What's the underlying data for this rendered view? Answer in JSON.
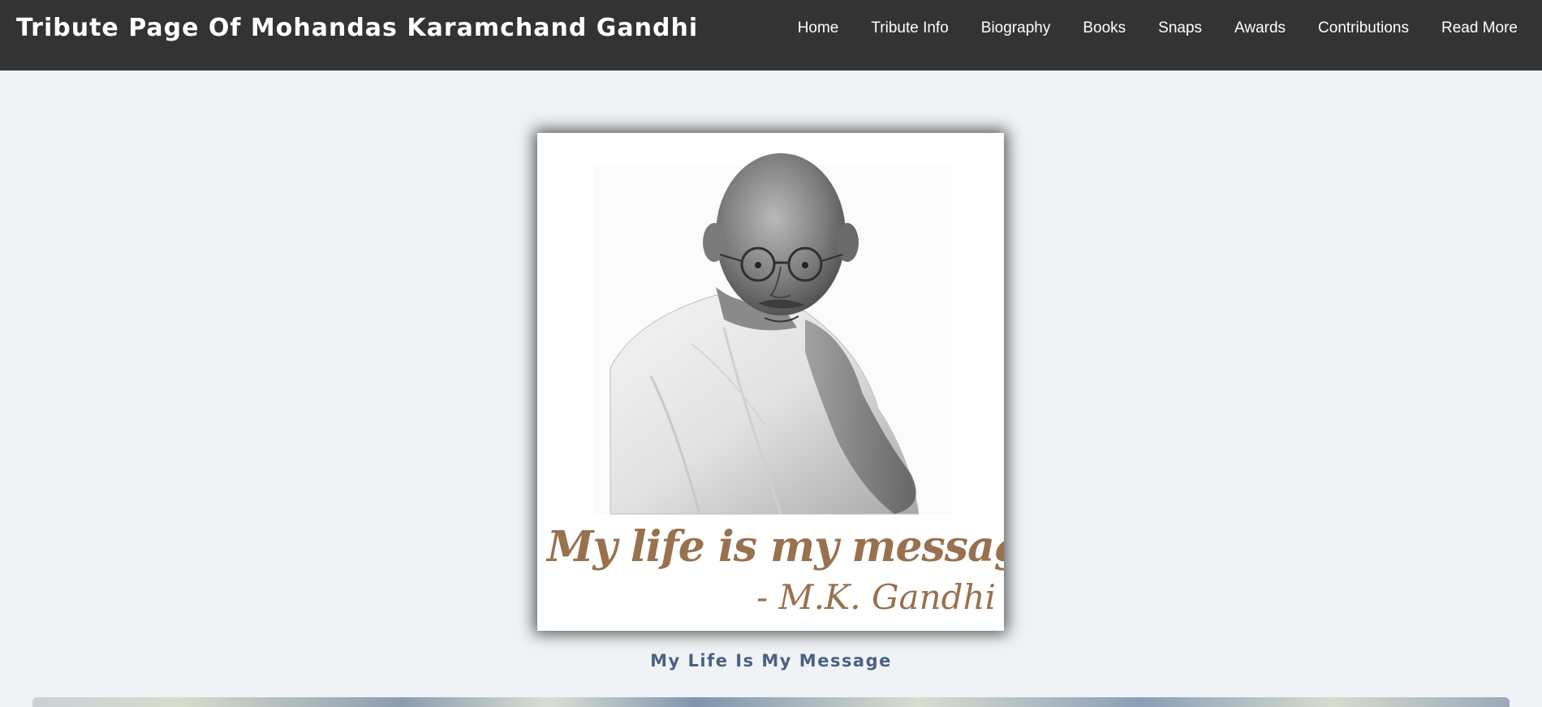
{
  "header": {
    "title": "Tribute Page Of Mohandas Karamchand Gandhi",
    "nav": [
      {
        "label": "Home"
      },
      {
        "label": "Tribute Info"
      },
      {
        "label": "Biography"
      },
      {
        "label": "Books"
      },
      {
        "label": "Snaps"
      },
      {
        "label": "Awards"
      },
      {
        "label": "Contributions"
      },
      {
        "label": "Read More"
      }
    ]
  },
  "portrait": {
    "quote": "My life is my message.",
    "author": "- M.K. Gandhi"
  },
  "caption": "My Life Is My Message",
  "colors": {
    "navbar": "#333333",
    "page_background": "#eff3f6",
    "quote_text": "#98714f",
    "caption_text": "#4a6280"
  }
}
